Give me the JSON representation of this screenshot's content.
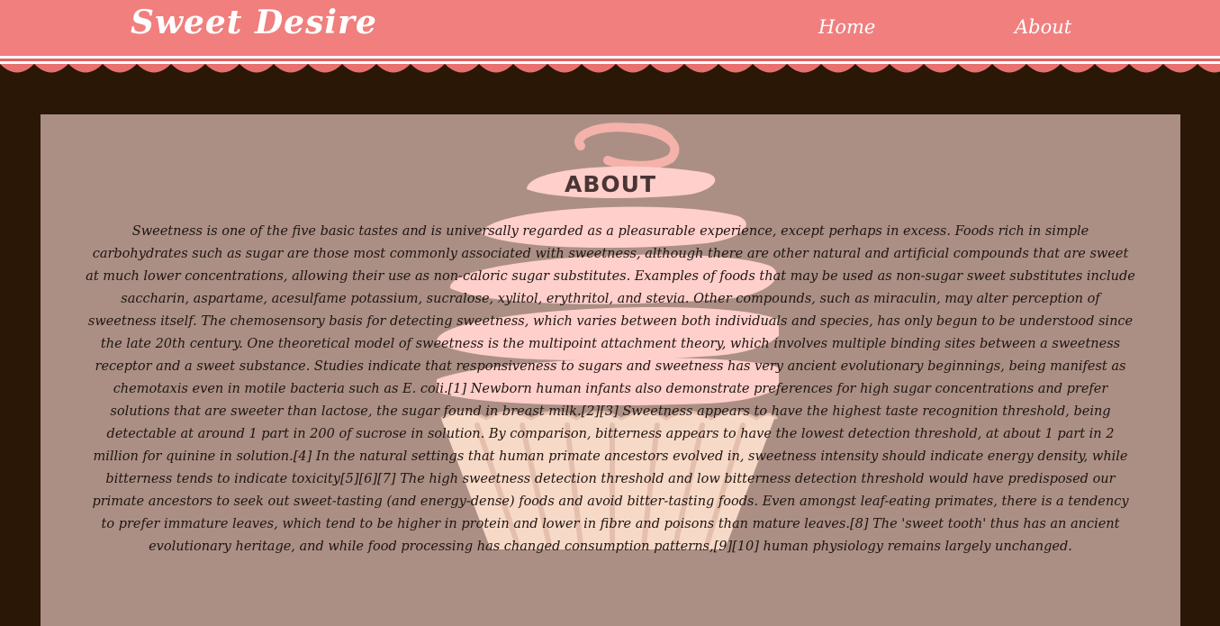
{
  "header": {
    "brand": "Sweet Desire",
    "nav": {
      "home": "Home",
      "about": "About"
    }
  },
  "colors": {
    "header": "#f07f7e",
    "background": "#2a1706",
    "panel": "#ab8f85",
    "frosting": "#ffd0cc",
    "cake": "#f7d9c7"
  },
  "decoration": {
    "image": "cupcake-illustration"
  },
  "main": {
    "heading": "ABOUT",
    "body": "Sweetness is one of the five basic tastes and is universally regarded as a pleasurable experience, except perhaps in excess. Foods rich in simple carbohydrates such as sugar are those most commonly associated with sweetness, although there are other natural and artificial compounds that are sweet at much lower concentrations, allowing their use as non-caloric sugar substitutes. Examples of foods that may be used as non-sugar sweet substitutes include saccharin, aspartame, acesulfame potassium, sucralose, xylitol, erythritol, and stevia. Other compounds, such as miraculin, may alter perception of sweetness itself. The chemosensory basis for detecting sweetness, which varies between both individuals and species, has only begun to be understood since the late 20th century. One theoretical model of sweetness is the multipoint attachment theory, which involves multiple binding sites between a sweetness receptor and a sweet substance. Studies indicate that responsiveness to sugars and sweetness has very ancient evolutionary beginnings, being manifest as chemotaxis even in motile bacteria such as E. coli.[1] Newborn human infants also demonstrate preferences for high sugar concentrations and prefer solutions that are sweeter than lactose, the sugar found in breast milk.[2][3] Sweetness appears to have the highest taste recognition threshold, being detectable at around 1 part in 200 of sucrose in solution. By comparison, bitterness appears to have the lowest detection threshold, at about 1 part in 2 million for quinine in solution.[4] In the natural settings that human primate ancestors evolved in, sweetness intensity should indicate energy density, while bitterness tends to indicate toxicity[5][6][7] The high sweetness detection threshold and low bitterness detection threshold would have predisposed our primate ancestors to seek out sweet-tasting (and energy-dense) foods and avoid bitter-tasting foods. Even amongst leaf-eating primates, there is a tendency to prefer immature leaves, which tend to be higher in protein and lower in fibre and poisons than mature leaves.[8] The 'sweet tooth' thus has an ancient evolutionary heritage, and while food processing has changed consumption patterns,[9][10] human physiology remains largely unchanged."
  }
}
